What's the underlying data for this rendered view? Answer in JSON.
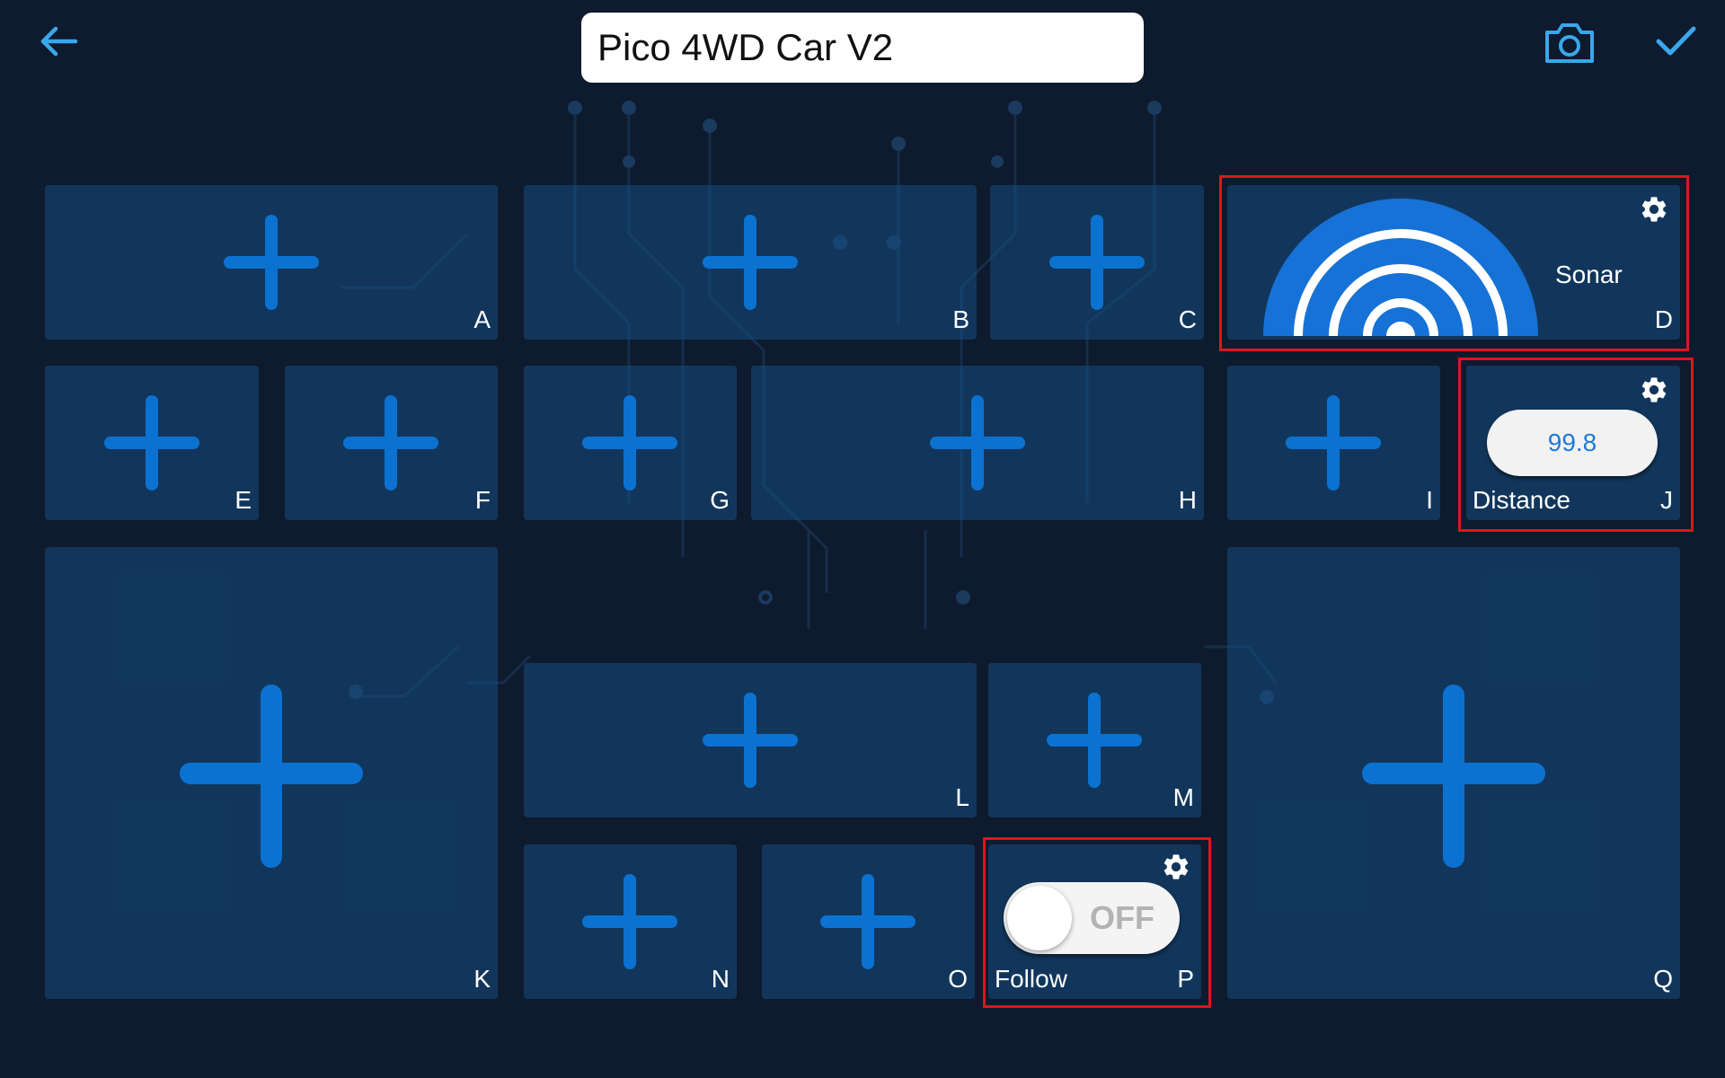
{
  "header": {
    "title": "Pico 4WD Car V2",
    "back_icon": "arrow-left-icon",
    "camera_icon": "camera-icon",
    "confirm_icon": "checkmark-icon"
  },
  "colors": {
    "background": "#0e1a2e",
    "accent": "#1e88e5",
    "tile": "#154e82",
    "highlight_frame": "#e0141e"
  },
  "slots": {
    "A": "A",
    "B": "B",
    "C": "C",
    "D": "D",
    "E": "E",
    "F": "F",
    "G": "G",
    "H": "H",
    "I": "I",
    "J": "J",
    "K": "K",
    "L": "L",
    "M": "M",
    "N": "N",
    "O": "O",
    "P": "P",
    "Q": "Q"
  },
  "widgets": {
    "sonar": {
      "label": "Sonar",
      "icon": "sonar-icon"
    },
    "distance": {
      "label": "Distance",
      "value": "99.8"
    },
    "follow": {
      "label": "Follow",
      "state": "OFF"
    }
  },
  "empty_slot_icon": "plus-icon",
  "settings_icon": "gear-icon"
}
